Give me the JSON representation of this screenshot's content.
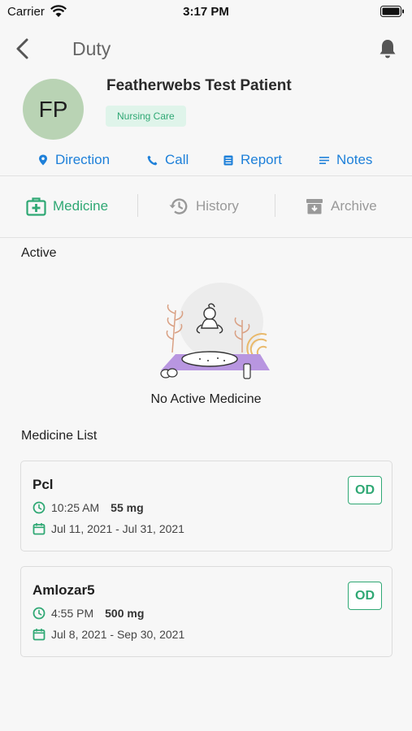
{
  "status_bar": {
    "carrier": "Carrier",
    "time": "3:17 PM"
  },
  "nav": {
    "title": "Duty"
  },
  "patient": {
    "initials": "FP",
    "name": "Featherwebs Test Patient",
    "badge": "Nursing Care"
  },
  "actions": [
    {
      "label": "Direction",
      "icon": "location-pin-icon"
    },
    {
      "label": "Call",
      "icon": "phone-icon"
    },
    {
      "label": "Report",
      "icon": "report-icon"
    },
    {
      "label": "Notes",
      "icon": "notes-icon"
    }
  ],
  "tabs": [
    {
      "label": "Medicine",
      "icon": "medicine-kit-icon",
      "active": true
    },
    {
      "label": "History",
      "icon": "history-icon",
      "active": false
    },
    {
      "label": "Archive",
      "icon": "archive-icon",
      "active": false
    }
  ],
  "active_section": {
    "title": "Active",
    "empty_text": "No Active Medicine"
  },
  "medicine_list": {
    "title": "Medicine List",
    "items": [
      {
        "name": "Pcl",
        "time": "10:25 AM",
        "dose": "55 mg",
        "dates": "Jul 11, 2021 - Jul 31, 2021",
        "frequency": "OD"
      },
      {
        "name": "Amlozar5",
        "time": "4:55 PM",
        "dose": "500 mg",
        "dates": "Jul 8, 2021 - Sep 30, 2021",
        "frequency": "OD"
      }
    ]
  },
  "colors": {
    "accent_green": "#2fa874",
    "link_blue": "#1e80d9",
    "avatar_bg": "#b9d3b4",
    "badge_bg": "#dff4ea"
  }
}
